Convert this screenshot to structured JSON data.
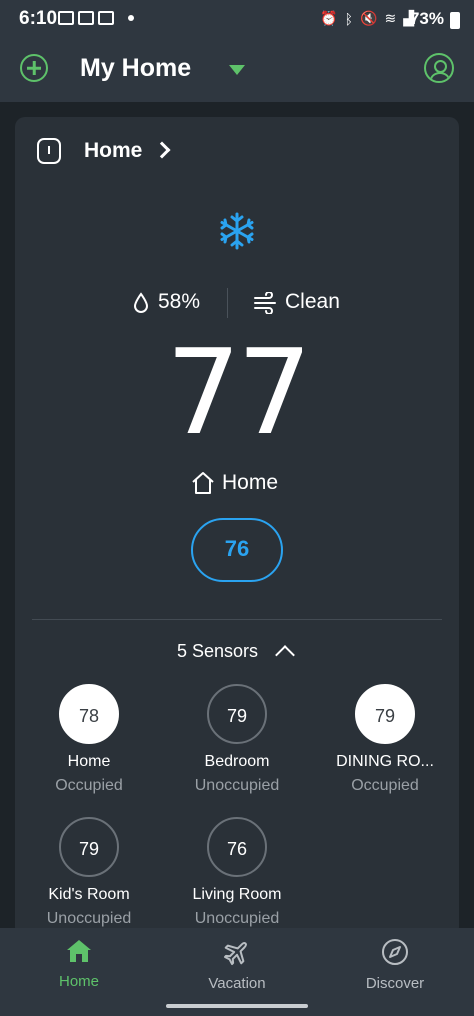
{
  "status_bar": {
    "time": "6:10",
    "battery": "73%"
  },
  "header": {
    "title": "My Home"
  },
  "card": {
    "title": "Home",
    "humidity": "58%",
    "air": "Clean",
    "current_temp": "77",
    "mode": "Home",
    "setpoint": "76"
  },
  "sensors": {
    "label": "5 Sensors",
    "items": [
      {
        "temp": "78",
        "name": "Home",
        "status": "Occupied",
        "occupied": true
      },
      {
        "temp": "79",
        "name": "Bedroom",
        "status": "Unoccupied",
        "occupied": false
      },
      {
        "temp": "79",
        "name": "DINING RO...",
        "status": "Occupied",
        "occupied": true
      },
      {
        "temp": "79",
        "name": "Kid's Room",
        "status": "Unoccupied",
        "occupied": false
      },
      {
        "temp": "76",
        "name": "Living Room",
        "status": "Unoccupied",
        "occupied": false
      }
    ]
  },
  "nav": {
    "items": [
      {
        "label": "Home",
        "icon": "house-icon",
        "active": true
      },
      {
        "label": "Vacation",
        "icon": "airplane-icon",
        "active": false
      },
      {
        "label": "Discover",
        "icon": "compass-icon",
        "active": false
      }
    ]
  },
  "colors": {
    "accent_green": "#5ec26a",
    "accent_blue": "#2aa3f0",
    "background": "#1d2328",
    "card": "#2a3138"
  }
}
